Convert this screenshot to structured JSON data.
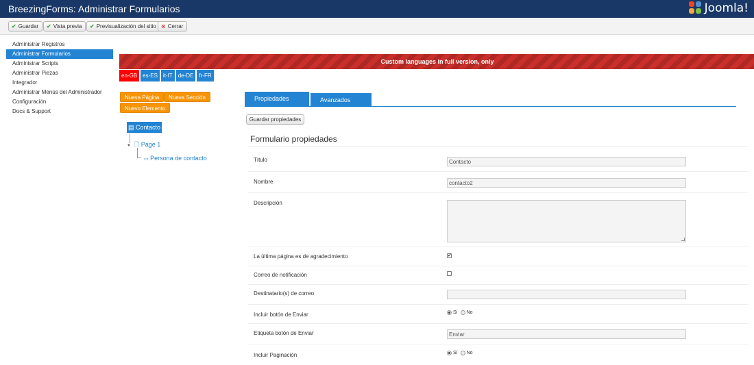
{
  "app": {
    "title": "BreezingForms: Administrar Formularios",
    "brand": "Joomla!"
  },
  "toolbar": {
    "save": "Guardar",
    "preview": "Vista previa",
    "site_preview": "Previsualización del sitio",
    "close": "Cerrar"
  },
  "sidebar": {
    "items": [
      {
        "label": "Administrar Registros"
      },
      {
        "label": "Administrar Formularios"
      },
      {
        "label": "Administrar Scripts"
      },
      {
        "label": "Administrar Piezas"
      },
      {
        "label": "Integrador"
      },
      {
        "label": "Administrar Menús del Administrador"
      },
      {
        "label": "Configuración"
      },
      {
        "label": "Docs & Support"
      }
    ],
    "active_index": 1
  },
  "banner": {
    "text": "Custom languages in full version, only"
  },
  "languages": {
    "items": [
      "en-GB",
      "es-ES",
      "it-IT",
      "de-DE",
      "fr-FR"
    ],
    "active": "en-GB"
  },
  "builder": {
    "new_page": "Nueva Página",
    "new_section": "Nueva Sección",
    "new_element": "Nuevo Elemento"
  },
  "tree": {
    "root": "Contacto",
    "page": "Page 1",
    "element": "Persona de contacto"
  },
  "tabs": {
    "properties": "Propiedades",
    "advanced": "Avanzados"
  },
  "save_properties": "Guardar propiedades",
  "form": {
    "heading": "Formulario propiedades",
    "title_label": "Título",
    "title_value": "Contacto",
    "name_label": "Nombre",
    "name_value": "contacto2",
    "description_label": "Descripción",
    "description_value": "",
    "last_page_thanks_label": "La última página es de agradecimiento",
    "last_page_thanks_checked": true,
    "notification_mail_label": "Correo de notificación",
    "notification_mail_checked": false,
    "mail_recipients_label": "Destinatario(s) de correo",
    "mail_recipients_value": "",
    "include_submit_label": "Incluir botón de Enviar",
    "include_submit_options": [
      "Sí",
      "No"
    ],
    "include_submit_selected": "Sí",
    "submit_label_label": "Etiqueta botón de Enviar",
    "submit_label_value": "Enviar",
    "include_pagination_label": "Incluir Paginación",
    "include_pagination_options": [
      "Sí",
      "No"
    ],
    "include_pagination_selected": "Sí"
  },
  "colors": {
    "header": "#1a3867",
    "accent": "#2384d3",
    "orange": "#f89406",
    "banner_red": "#c9302c",
    "lang_active": "#ff0000"
  }
}
